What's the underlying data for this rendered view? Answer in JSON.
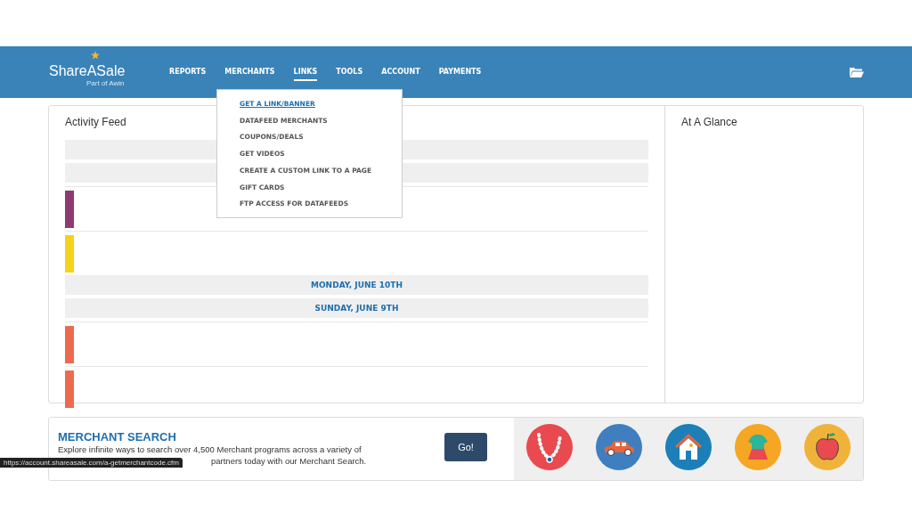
{
  "header": {
    "logo": "ShareASale",
    "logo_tagline": "Part of Awin",
    "nav": [
      {
        "label": "REPORTS",
        "selected": false
      },
      {
        "label": "MERCHANTS",
        "selected": false
      },
      {
        "label": "LINKS",
        "selected": true
      },
      {
        "label": "TOOLS",
        "selected": false
      },
      {
        "label": "ACCOUNT",
        "selected": false
      },
      {
        "label": "PAYMENTS",
        "selected": false
      }
    ]
  },
  "links_menu": [
    {
      "label": "GET A LINK/BANNER",
      "selected": true
    },
    {
      "label": "DATAFEED MERCHANTS",
      "selected": false
    },
    {
      "label": "COUPONS/DEALS",
      "selected": false
    },
    {
      "label": "GET VIDEOS",
      "selected": false
    },
    {
      "label": "CREATE A CUSTOM LINK TO A PAGE",
      "selected": false
    },
    {
      "label": "GIFT CARDS",
      "selected": false
    },
    {
      "label": "FTP ACCESS FOR DATAFEEDS",
      "selected": false
    }
  ],
  "activity_feed": {
    "title": "Activity Feed",
    "items": [
      {
        "kind": "header"
      },
      {
        "kind": "header"
      },
      {
        "kind": "entry",
        "color": "#8e3b72"
      },
      {
        "kind": "entry",
        "color": "#f5d21b"
      },
      {
        "kind": "date",
        "label": "MONDAY, JUNE 10TH"
      },
      {
        "kind": "date",
        "label": "SUNDAY, JUNE 9TH"
      },
      {
        "kind": "entry",
        "color": "#ee6a4f"
      },
      {
        "kind": "entry",
        "color": "#ee6a4f"
      }
    ]
  },
  "at_a_glance": {
    "title": "At A Glance"
  },
  "merchant_search": {
    "title": "MERCHANT SEARCH",
    "description_line_1": "Explore infinite ways to search over 4,500 Merchant programs across a variety of",
    "description_line_2": "partners today with our Merchant Search.",
    "button": "Go!",
    "categories": [
      {
        "kind": "necklace"
      },
      {
        "kind": "car"
      },
      {
        "kind": "house"
      },
      {
        "kind": "dress"
      },
      {
        "kind": "apple"
      }
    ]
  },
  "status_url": "https://account.shareasale.com/a-getmerchantcode.cfm"
}
